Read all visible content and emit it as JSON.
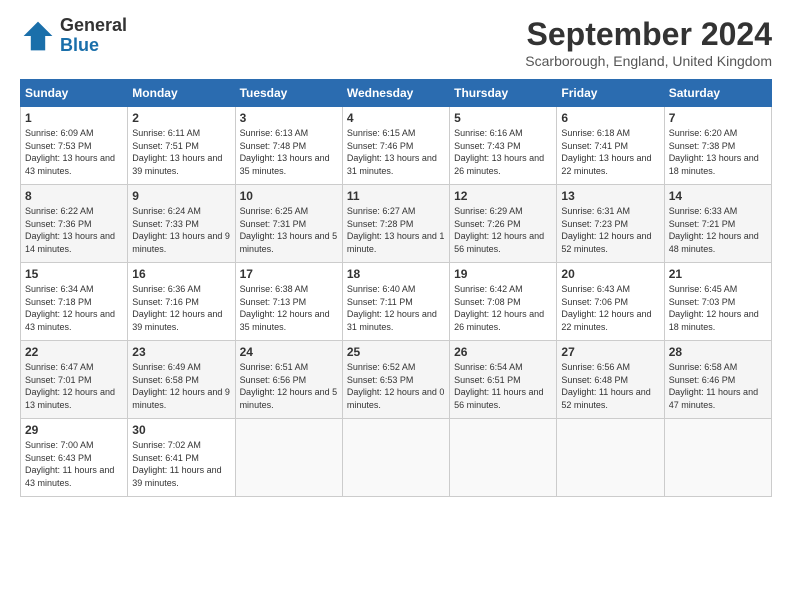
{
  "header": {
    "logo_general": "General",
    "logo_blue": "Blue",
    "month_title": "September 2024",
    "location": "Scarborough, England, United Kingdom"
  },
  "weekdays": [
    "Sunday",
    "Monday",
    "Tuesday",
    "Wednesday",
    "Thursday",
    "Friday",
    "Saturday"
  ],
  "weeks": [
    [
      {
        "day": "1",
        "sunrise": "6:09 AM",
        "sunset": "7:53 PM",
        "daylight": "13 hours and 43 minutes."
      },
      {
        "day": "2",
        "sunrise": "6:11 AM",
        "sunset": "7:51 PM",
        "daylight": "13 hours and 39 minutes."
      },
      {
        "day": "3",
        "sunrise": "6:13 AM",
        "sunset": "7:48 PM",
        "daylight": "13 hours and 35 minutes."
      },
      {
        "day": "4",
        "sunrise": "6:15 AM",
        "sunset": "7:46 PM",
        "daylight": "13 hours and 31 minutes."
      },
      {
        "day": "5",
        "sunrise": "6:16 AM",
        "sunset": "7:43 PM",
        "daylight": "13 hours and 26 minutes."
      },
      {
        "day": "6",
        "sunrise": "6:18 AM",
        "sunset": "7:41 PM",
        "daylight": "13 hours and 22 minutes."
      },
      {
        "day": "7",
        "sunrise": "6:20 AM",
        "sunset": "7:38 PM",
        "daylight": "13 hours and 18 minutes."
      }
    ],
    [
      {
        "day": "8",
        "sunrise": "6:22 AM",
        "sunset": "7:36 PM",
        "daylight": "13 hours and 14 minutes."
      },
      {
        "day": "9",
        "sunrise": "6:24 AM",
        "sunset": "7:33 PM",
        "daylight": "13 hours and 9 minutes."
      },
      {
        "day": "10",
        "sunrise": "6:25 AM",
        "sunset": "7:31 PM",
        "daylight": "13 hours and 5 minutes."
      },
      {
        "day": "11",
        "sunrise": "6:27 AM",
        "sunset": "7:28 PM",
        "daylight": "13 hours and 1 minute."
      },
      {
        "day": "12",
        "sunrise": "6:29 AM",
        "sunset": "7:26 PM",
        "daylight": "12 hours and 56 minutes."
      },
      {
        "day": "13",
        "sunrise": "6:31 AM",
        "sunset": "7:23 PM",
        "daylight": "12 hours and 52 minutes."
      },
      {
        "day": "14",
        "sunrise": "6:33 AM",
        "sunset": "7:21 PM",
        "daylight": "12 hours and 48 minutes."
      }
    ],
    [
      {
        "day": "15",
        "sunrise": "6:34 AM",
        "sunset": "7:18 PM",
        "daylight": "12 hours and 43 minutes."
      },
      {
        "day": "16",
        "sunrise": "6:36 AM",
        "sunset": "7:16 PM",
        "daylight": "12 hours and 39 minutes."
      },
      {
        "day": "17",
        "sunrise": "6:38 AM",
        "sunset": "7:13 PM",
        "daylight": "12 hours and 35 minutes."
      },
      {
        "day": "18",
        "sunrise": "6:40 AM",
        "sunset": "7:11 PM",
        "daylight": "12 hours and 31 minutes."
      },
      {
        "day": "19",
        "sunrise": "6:42 AM",
        "sunset": "7:08 PM",
        "daylight": "12 hours and 26 minutes."
      },
      {
        "day": "20",
        "sunrise": "6:43 AM",
        "sunset": "7:06 PM",
        "daylight": "12 hours and 22 minutes."
      },
      {
        "day": "21",
        "sunrise": "6:45 AM",
        "sunset": "7:03 PM",
        "daylight": "12 hours and 18 minutes."
      }
    ],
    [
      {
        "day": "22",
        "sunrise": "6:47 AM",
        "sunset": "7:01 PM",
        "daylight": "12 hours and 13 minutes."
      },
      {
        "day": "23",
        "sunrise": "6:49 AM",
        "sunset": "6:58 PM",
        "daylight": "12 hours and 9 minutes."
      },
      {
        "day": "24",
        "sunrise": "6:51 AM",
        "sunset": "6:56 PM",
        "daylight": "12 hours and 5 minutes."
      },
      {
        "day": "25",
        "sunrise": "6:52 AM",
        "sunset": "6:53 PM",
        "daylight": "12 hours and 0 minutes."
      },
      {
        "day": "26",
        "sunrise": "6:54 AM",
        "sunset": "6:51 PM",
        "daylight": "11 hours and 56 minutes."
      },
      {
        "day": "27",
        "sunrise": "6:56 AM",
        "sunset": "6:48 PM",
        "daylight": "11 hours and 52 minutes."
      },
      {
        "day": "28",
        "sunrise": "6:58 AM",
        "sunset": "6:46 PM",
        "daylight": "11 hours and 47 minutes."
      }
    ],
    [
      {
        "day": "29",
        "sunrise": "7:00 AM",
        "sunset": "6:43 PM",
        "daylight": "11 hours and 43 minutes."
      },
      {
        "day": "30",
        "sunrise": "7:02 AM",
        "sunset": "6:41 PM",
        "daylight": "11 hours and 39 minutes."
      },
      null,
      null,
      null,
      null,
      null
    ]
  ],
  "labels": {
    "sunrise": "Sunrise:",
    "sunset": "Sunset:",
    "daylight": "Daylight:"
  }
}
